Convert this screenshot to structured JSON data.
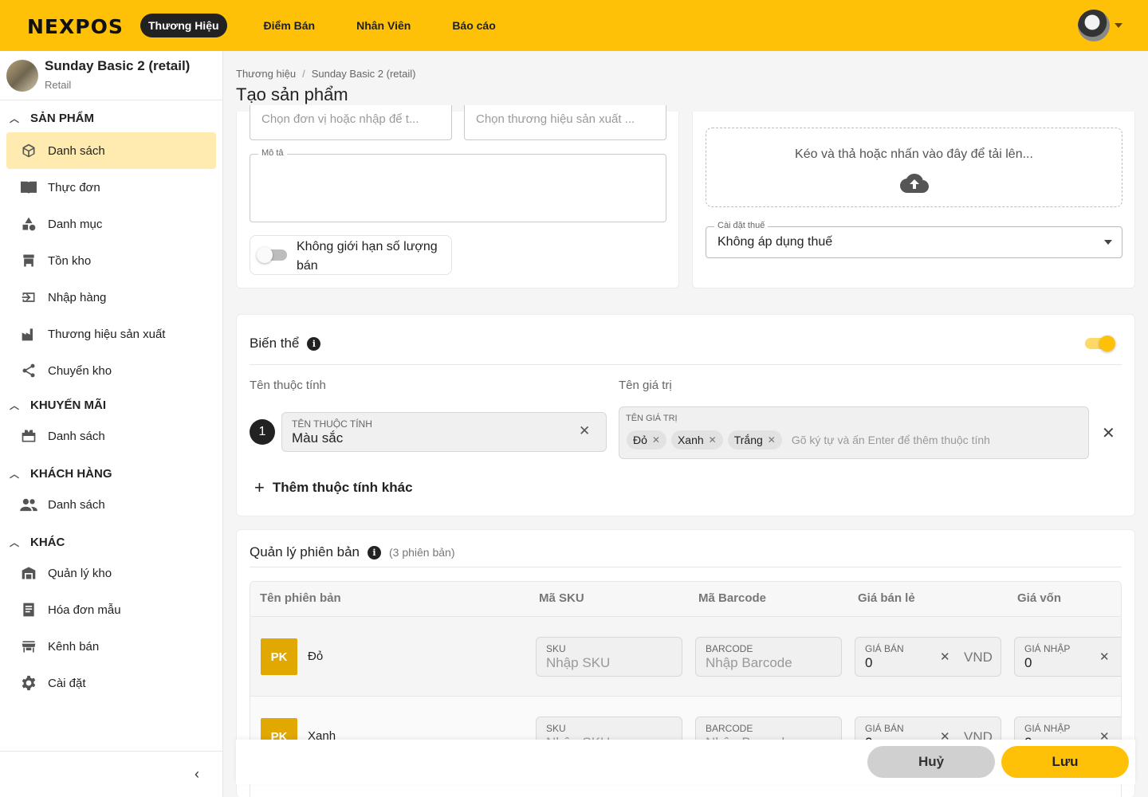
{
  "topbar": {
    "logo": "NEXPOS",
    "nav": [
      "Thương Hiệu",
      "Điểm Bán",
      "Nhân Viên",
      "Báo cáo"
    ],
    "accent": "#ffc107"
  },
  "store": {
    "name": "Sunday Basic 2 (retail)",
    "type": "Retail"
  },
  "sidebar": {
    "sections": [
      {
        "title": "SẢN PHẨM",
        "items": [
          {
            "label": "Danh sách",
            "icon": "box-icon",
            "active": true
          },
          {
            "label": "Thực đơn",
            "icon": "menu-book-icon"
          },
          {
            "label": "Danh mục",
            "icon": "category-icon"
          },
          {
            "label": "Tồn kho",
            "icon": "inventory-icon"
          },
          {
            "label": "Nhập hàng",
            "icon": "input-icon"
          },
          {
            "label": "Thương hiệu sản xuất",
            "icon": "factory-icon"
          },
          {
            "label": "Chuyển kho",
            "icon": "share-icon"
          }
        ]
      },
      {
        "title": "KHUYẾN MÃI",
        "items": [
          {
            "label": "Danh sách",
            "icon": "gift-card-icon"
          }
        ]
      },
      {
        "title": "KHÁCH HÀNG",
        "items": [
          {
            "label": "Danh sách",
            "icon": "people-icon"
          }
        ]
      },
      {
        "title": "KHÁC",
        "items": [
          {
            "label": "Quản lý kho",
            "icon": "warehouse-icon"
          },
          {
            "label": "Hóa đơn mẫu",
            "icon": "receipt-icon"
          },
          {
            "label": "Kênh bán",
            "icon": "store-icon"
          },
          {
            "label": "Cài đặt",
            "icon": "gear-icon"
          }
        ]
      }
    ]
  },
  "breadcrumb": [
    "Thương hiệu",
    "Sunday Basic 2 (retail)"
  ],
  "page_title": "Tạo sản phẩm",
  "info_card": {
    "unit_placeholder": "Chọn đơn vị hoặc nhập để t...",
    "brand_placeholder": "Chọn thương hiệu sản xuất ...",
    "description_label": "Mô tả",
    "unlimited_label": "Không giới hạn số lượng bán"
  },
  "media_card": {
    "upload_text": "Kéo và thả hoặc nhấn vào đây để tải lên...",
    "tax_label": "Cài đặt thuế",
    "tax_value": "Không áp dụng thuế"
  },
  "variants": {
    "title": "Biến thể",
    "enabled": true,
    "col_attr": "Tên thuộc tính",
    "col_values": "Tên giá trị",
    "attribute": {
      "index": "1",
      "label": "TÊN THUỘC TÍNH",
      "value": "Màu sắc",
      "values_label": "TÊN GIÁ TRỊ",
      "values": [
        "Đỏ",
        "Xanh",
        "Trắng"
      ],
      "values_placeholder": "Gõ ký tự và ấn Enter để thêm thuộc tính"
    },
    "add_label": "Thêm thuộc tính khác"
  },
  "versions": {
    "title": "Quản lý phiên bản",
    "count": "(3 phiên bản)",
    "headers": [
      "Tên phiên bản",
      "Mã SKU",
      "Mã Barcode",
      "Giá bán lẻ",
      "Giá vốn"
    ],
    "rows": [
      {
        "badge": "PK",
        "name": "Đỏ",
        "sku_label": "SKU",
        "sku_placeholder": "Nhập SKU",
        "barcode_label": "BARCODE",
        "barcode_placeholder": "Nhập Barcode",
        "price_label": "GIÁ BÁN",
        "price": "0",
        "currency": "VND",
        "cost_label": "GIÁ NHẬP",
        "cost": "0"
      },
      {
        "badge": "PK",
        "name": "Xanh",
        "sku_label": "SKU",
        "sku_placeholder": "Nhập SKU",
        "barcode_label": "BARCODE",
        "barcode_placeholder": "Nhập Barcode",
        "price_label": "GIÁ BÁN",
        "price": "0",
        "currency": "VND",
        "cost_label": "GIÁ NHẬP",
        "cost": "0"
      }
    ]
  },
  "actions": {
    "cancel": "Huỷ",
    "save": "Lưu"
  }
}
